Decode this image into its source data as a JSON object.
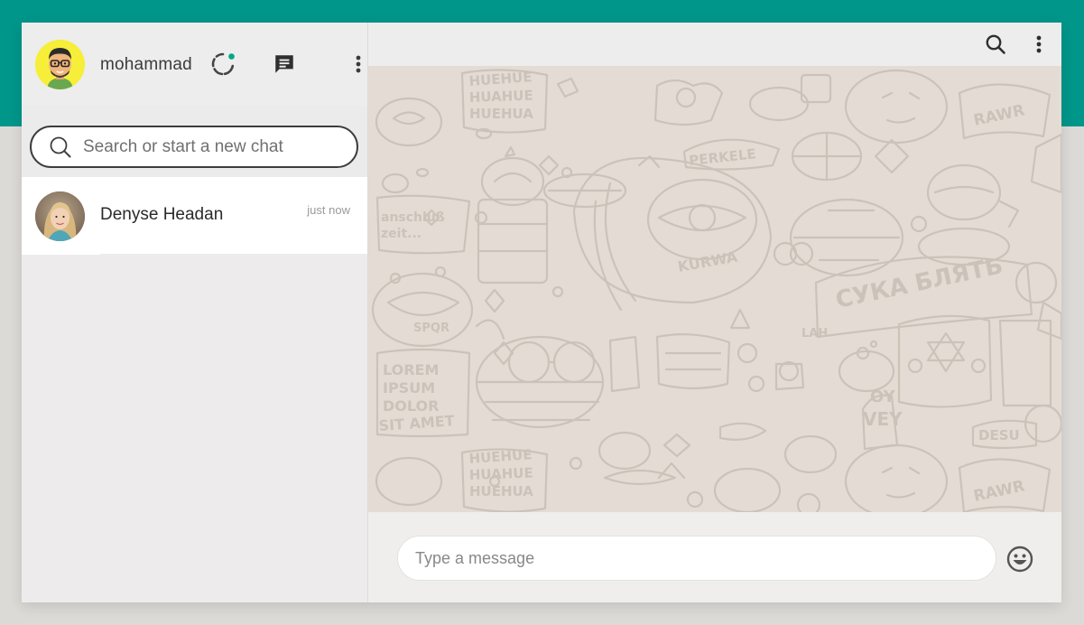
{
  "colors": {
    "brand": "#00968a",
    "status_dot": "#00a884",
    "chat_background": "#e4dcd4",
    "doodle_stroke": "#cbc3ba"
  },
  "sidebar": {
    "user": {
      "name": "mohammad",
      "avatar": "avatar-icon"
    },
    "icons": [
      "status-icon",
      "new-chat-icon",
      "more-vert-icon"
    ],
    "search": {
      "placeholder": "Search or start a new chat",
      "icon": "search-icon"
    },
    "chats": [
      {
        "name": "Denyse Headan",
        "time": "just now"
      }
    ]
  },
  "main": {
    "header_icons": [
      "search-icon",
      "more-vert-icon"
    ],
    "wallpaper_text": {
      "t1": "HUEHUE",
      "t2": "HUAHUE",
      "t3": "HUEHUA",
      "t4": "PERKELE",
      "t5": "RAWR",
      "t6": "anschluß",
      "t7": "zeit...",
      "t8": "KURWA",
      "t9": "СУКА БЛЯТЬ",
      "t10": "SPQR",
      "t11": "LAH",
      "t12": "LOREM",
      "t13": "IPSUM",
      "t14": "DOLOR",
      "t15": "SIT AMET",
      "t16": "OY",
      "t17": "VEY",
      "t18": "DESU",
      "t19": "HUEHUE",
      "t20": "HUAHUE",
      "t21": "HUEHUA",
      "t22": "RAWR"
    },
    "composer": {
      "placeholder": "Type a message",
      "emoji_icon": "emoji-icon"
    }
  }
}
